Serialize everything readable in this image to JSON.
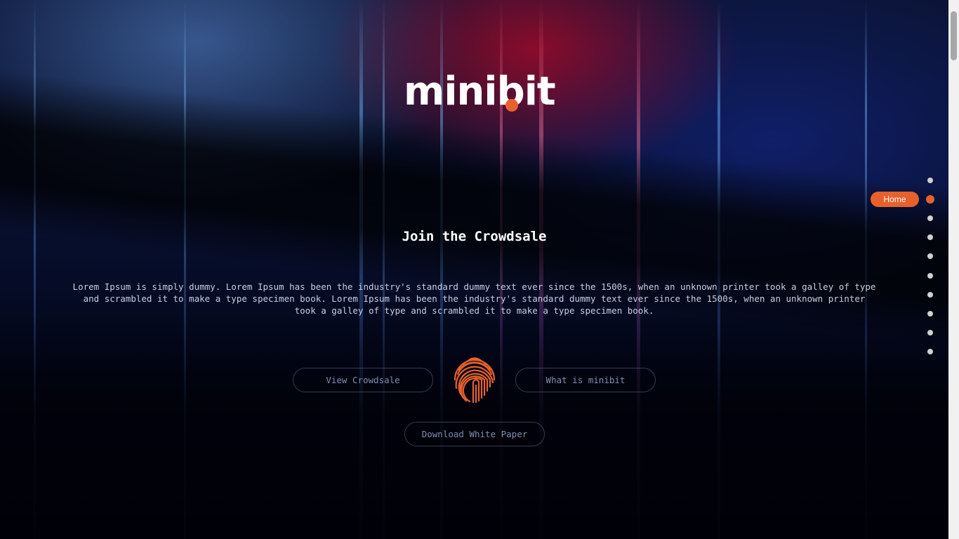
{
  "brand": {
    "logo_text": "minibit",
    "accent_color": "#e8612c"
  },
  "hero": {
    "title": "Join the Crowdsale",
    "description": "Lorem Ipsum is simply dummy. Lorem Ipsum has been the industry's standard dummy text ever since the 1500s, when an unknown printer took a galley of type and scrambled it to make a type specimen book. Lorem Ipsum has been the industry's standard dummy text ever since the 1500s, when an unknown printer took a galley of type and scrambled it to make a type specimen book."
  },
  "buttons": {
    "view_crowdsale": "View Crowdsale",
    "what_is": "What is minibit",
    "download_paper": "Download White Paper"
  },
  "section_nav": {
    "active_label": "Home",
    "active_index": 1,
    "dot_count": 10
  },
  "icons": {
    "center": "fingerprint-icon"
  }
}
